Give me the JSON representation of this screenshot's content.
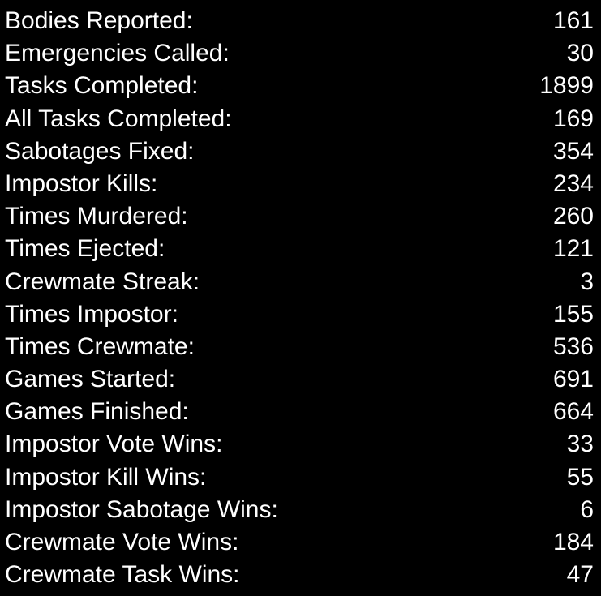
{
  "stats": [
    {
      "label": "Bodies Reported:",
      "value": "161"
    },
    {
      "label": "Emergencies Called:",
      "value": "30"
    },
    {
      "label": "Tasks Completed:",
      "value": "1899"
    },
    {
      "label": "All Tasks Completed:",
      "value": "169"
    },
    {
      "label": "Sabotages Fixed:",
      "value": "354"
    },
    {
      "label": "Impostor Kills:",
      "value": "234"
    },
    {
      "label": "Times Murdered:",
      "value": "260"
    },
    {
      "label": "Times Ejected:",
      "value": "121"
    },
    {
      "label": "Crewmate Streak:",
      "value": "3"
    },
    {
      "label": "Times Impostor:",
      "value": "155"
    },
    {
      "label": "Times Crewmate:",
      "value": "536"
    },
    {
      "label": "Games Started:",
      "value": "691"
    },
    {
      "label": "Games Finished:",
      "value": "664"
    },
    {
      "label": "Impostor Vote Wins:",
      "value": "33"
    },
    {
      "label": "Impostor Kill Wins:",
      "value": "55"
    },
    {
      "label": "Impostor Sabotage Wins:",
      "value": "6"
    },
    {
      "label": "Crewmate Vote Wins:",
      "value": "184"
    },
    {
      "label": "Crewmate Task Wins:",
      "value": "47"
    }
  ],
  "colors": {
    "background": "#000000",
    "text": "#ffffff"
  }
}
